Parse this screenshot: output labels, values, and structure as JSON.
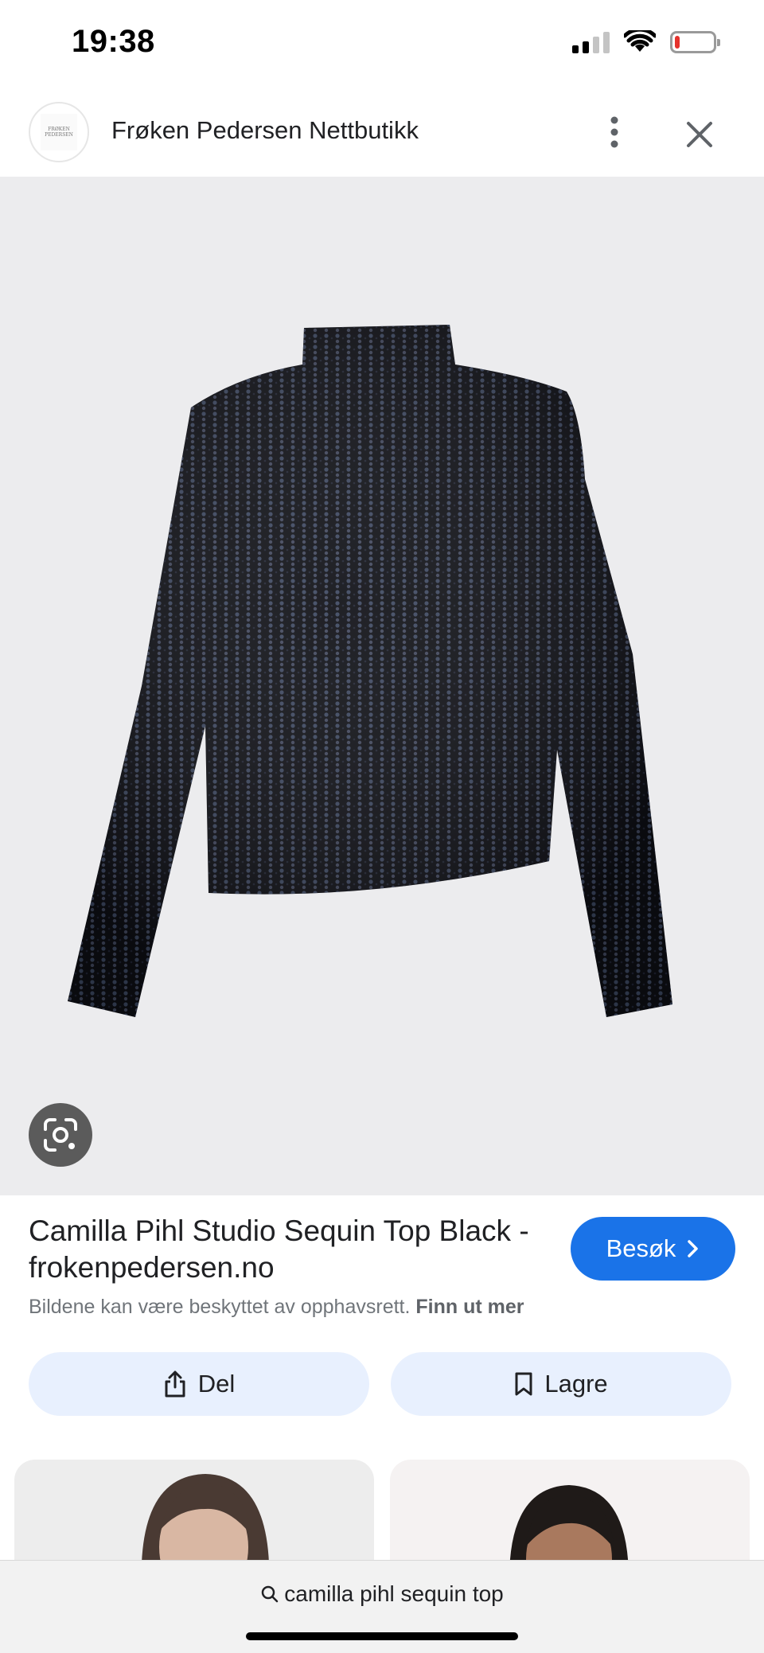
{
  "status_bar": {
    "time": "19:38",
    "battery_level": 0.12,
    "battery_color": "#e5322d",
    "signal_bars_active": 2,
    "icons": [
      "signal-icon",
      "wifi-icon",
      "battery-icon"
    ]
  },
  "header": {
    "site_name": "Frøken Pedersen Nettbutikk",
    "logo_text": [
      "FRØKEN",
      "PEDERSEN"
    ],
    "icons": [
      "more-vert-icon",
      "close-icon"
    ]
  },
  "viewer": {
    "lens_icon": "google-lens-icon"
  },
  "result": {
    "title": "Camilla Pihl Studio Sequin Top Black - frokenpedersen.no",
    "visit_label": "Besøk",
    "visit_icon": "chevron-right-icon",
    "copyright_text": "Bildene kan være beskyttet av opphavsrett.",
    "learn_more": "Finn ut mer",
    "accent_color": "#1a73e8"
  },
  "actions": {
    "share_label": "Del",
    "share_icon": "share-icon",
    "save_label": "Lagre",
    "save_icon": "bookmark-icon"
  },
  "search": {
    "query": "camilla pihl sequin top",
    "icon": "search-icon"
  }
}
